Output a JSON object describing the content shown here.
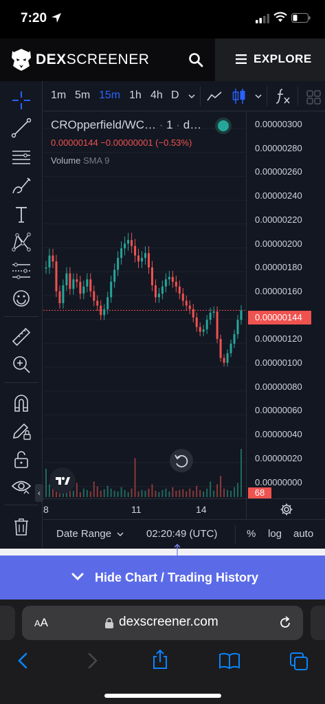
{
  "status": {
    "time": "7:20"
  },
  "header": {
    "brand_bold": "DEX",
    "brand_rest": "SCREENER",
    "explore_label": "EXPLORE"
  },
  "toolbar": {
    "timeframes": [
      "1m",
      "5m",
      "15m",
      "1h",
      "4h",
      "D"
    ],
    "active_timeframe": "15m"
  },
  "legend": {
    "symbol": "CROpperfield/WC…",
    "interval": "1",
    "exchange": "d…",
    "price_line": "0.00000144 −0.00000001 (−0.53%)",
    "volume_label": "Volume",
    "volume_sma": "SMA 9"
  },
  "price_axis": {
    "ticks": [
      "0.00000300",
      "0.00000280",
      "0.00000260",
      "0.00000240",
      "0.00000220",
      "0.00000200",
      "0.00000180",
      "0.00000160",
      "0.00000140",
      "0.00000120",
      "0.00000100",
      "0.00000080",
      "0.00000060",
      "0.00000040",
      "0.00000020",
      "0.00000000"
    ],
    "current_price_label": "0.00000144",
    "volume_label": "68"
  },
  "time_axis": {
    "ticks": [
      "8",
      "11",
      "14"
    ]
  },
  "bottom_bar": {
    "date_range": "Date Range",
    "clock": "02:20:49 (UTC)",
    "percent": "%",
    "log": "log",
    "auto": "auto"
  },
  "chart_data": {
    "type": "candlestick",
    "y_unit": "price",
    "ylim": [
      0,
      3e-06
    ],
    "current_price": 1.44e-06,
    "close_series": [
      1.8e-06,
      1.9e-06,
      1.85e-06,
      1.6e-06,
      1.5e-06,
      1.65e-06,
      1.75e-06,
      1.62e-06,
      1.7e-06,
      1.68e-06,
      1.58e-06,
      1.64e-06,
      1.7e-06,
      1.6e-06,
      1.52e-06,
      1.48e-06,
      1.4e-06,
      1.45e-06,
      1.55e-06,
      1.68e-06,
      1.78e-06,
      1.88e-06,
      1.96e-06,
      2e-06,
      2.03e-06,
      1.98e-06,
      1.9e-06,
      1.85e-06,
      1.88e-06,
      1.92e-06,
      1.8e-06,
      1.65e-06,
      1.55e-06,
      1.58e-06,
      1.64e-06,
      1.7e-06,
      1.72e-06,
      1.68e-06,
      1.64e-06,
      1.58e-06,
      1.52e-06,
      1.48e-06,
      1.45e-06,
      1.38e-06,
      1.3e-06,
      1.26e-06,
      1.28e-06,
      1.36e-06,
      1.42e-06,
      1.43e-06,
      1.2e-06,
      1.04e-06,
      1e-06,
      1.08e-06,
      1.16e-06,
      1.24e-06,
      1.36e-06,
      1.44e-06
    ],
    "volume": [
      40,
      18,
      12,
      8,
      30,
      10,
      6,
      14,
      9,
      20,
      7,
      12,
      10,
      8,
      22,
      15,
      9,
      11,
      16,
      12,
      9,
      8,
      14,
      10,
      7,
      12,
      55,
      8,
      10,
      9,
      12,
      18,
      9,
      7,
      10,
      12,
      8,
      14,
      9,
      10,
      11,
      8,
      12,
      9,
      16,
      10,
      8,
      12,
      22,
      9,
      18,
      30,
      12,
      10,
      9,
      14,
      20,
      68
    ]
  }
}
